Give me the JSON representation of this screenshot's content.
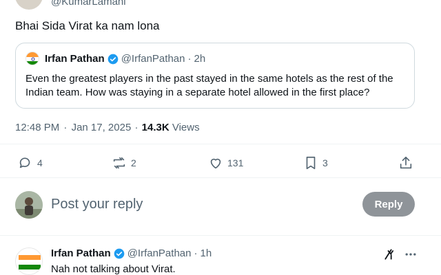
{
  "top_tweet": {
    "handle": "@KumarLamani",
    "text": "Bhai Sida Virat ka nam lona"
  },
  "quoted_tweet": {
    "name": "Irfan Pathan",
    "handle": "@IrfanPathan",
    "separator": "·",
    "time": "2h",
    "text": "Even the greatest players in the past stayed in the same hotels as the rest of the Indian team. How was staying in a separate hotel allowed in the first place?"
  },
  "meta": {
    "time": "12:48 PM",
    "separator": "·",
    "date": "Jan 17, 2025",
    "views_count": "14.3K",
    "views_label": "Views"
  },
  "actions": {
    "replies": "4",
    "reposts": "2",
    "likes": "131",
    "bookmarks": "3"
  },
  "reply_box": {
    "placeholder": "Post your reply",
    "button_label": "Reply"
  },
  "comment": {
    "name": "Irfan Pathan",
    "handle": "@IrfanPathan",
    "separator": "·",
    "time": "1h",
    "text": "Nah not talking about Virat."
  },
  "colors": {
    "text": "#0f1419",
    "muted": "#536471",
    "verified": "#1d9bf0",
    "reply_button": "#8f9499",
    "border": "#cfd9de"
  },
  "icons": [
    "reply-icon",
    "repost-icon",
    "like-icon",
    "bookmark-icon",
    "share-icon",
    "verified-icon",
    "grok-icon",
    "more-icon"
  ]
}
